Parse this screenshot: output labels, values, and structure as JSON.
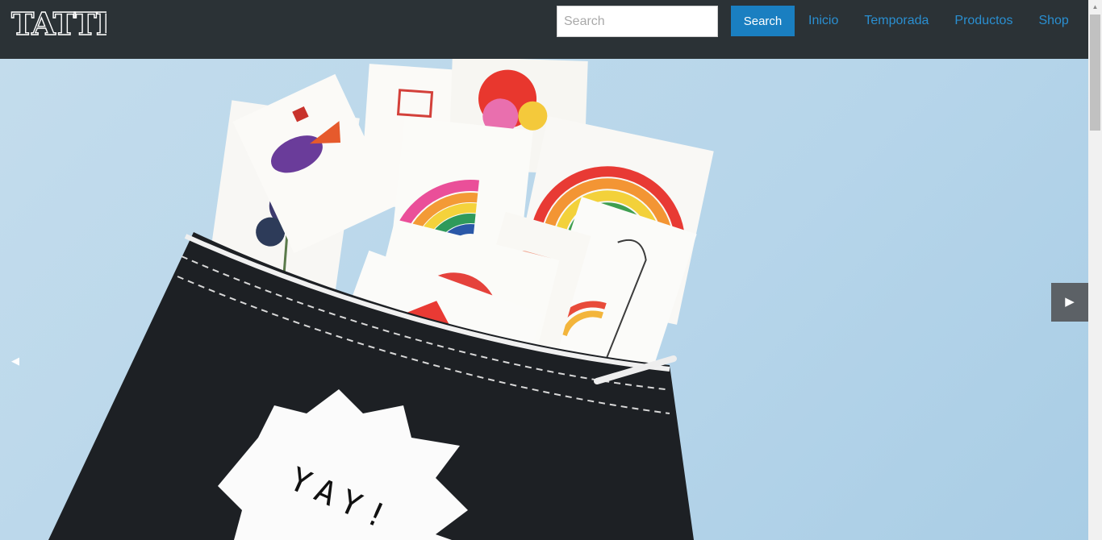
{
  "header": {
    "logo_text": "TATTLY",
    "search": {
      "placeholder": "Search",
      "value": "",
      "button_label": "Search"
    },
    "nav": [
      "Inicio",
      "Temporada",
      "Productos",
      "Shop"
    ]
  },
  "hero": {
    "pouch_text": "YAY!",
    "prev_arrow": "◀",
    "next_arrow": "▶"
  },
  "scrollbar": {
    "up_arrow": "▲"
  },
  "colors": {
    "header_bg": "#2b3236",
    "accent_button": "#1a7fc1",
    "nav_link": "#2a8fd1",
    "hero_bg": "#bcd9ec"
  },
  "icons": [
    "tattly-logo",
    "chevron-left-icon",
    "chevron-right-icon",
    "scroll-up-icon"
  ]
}
